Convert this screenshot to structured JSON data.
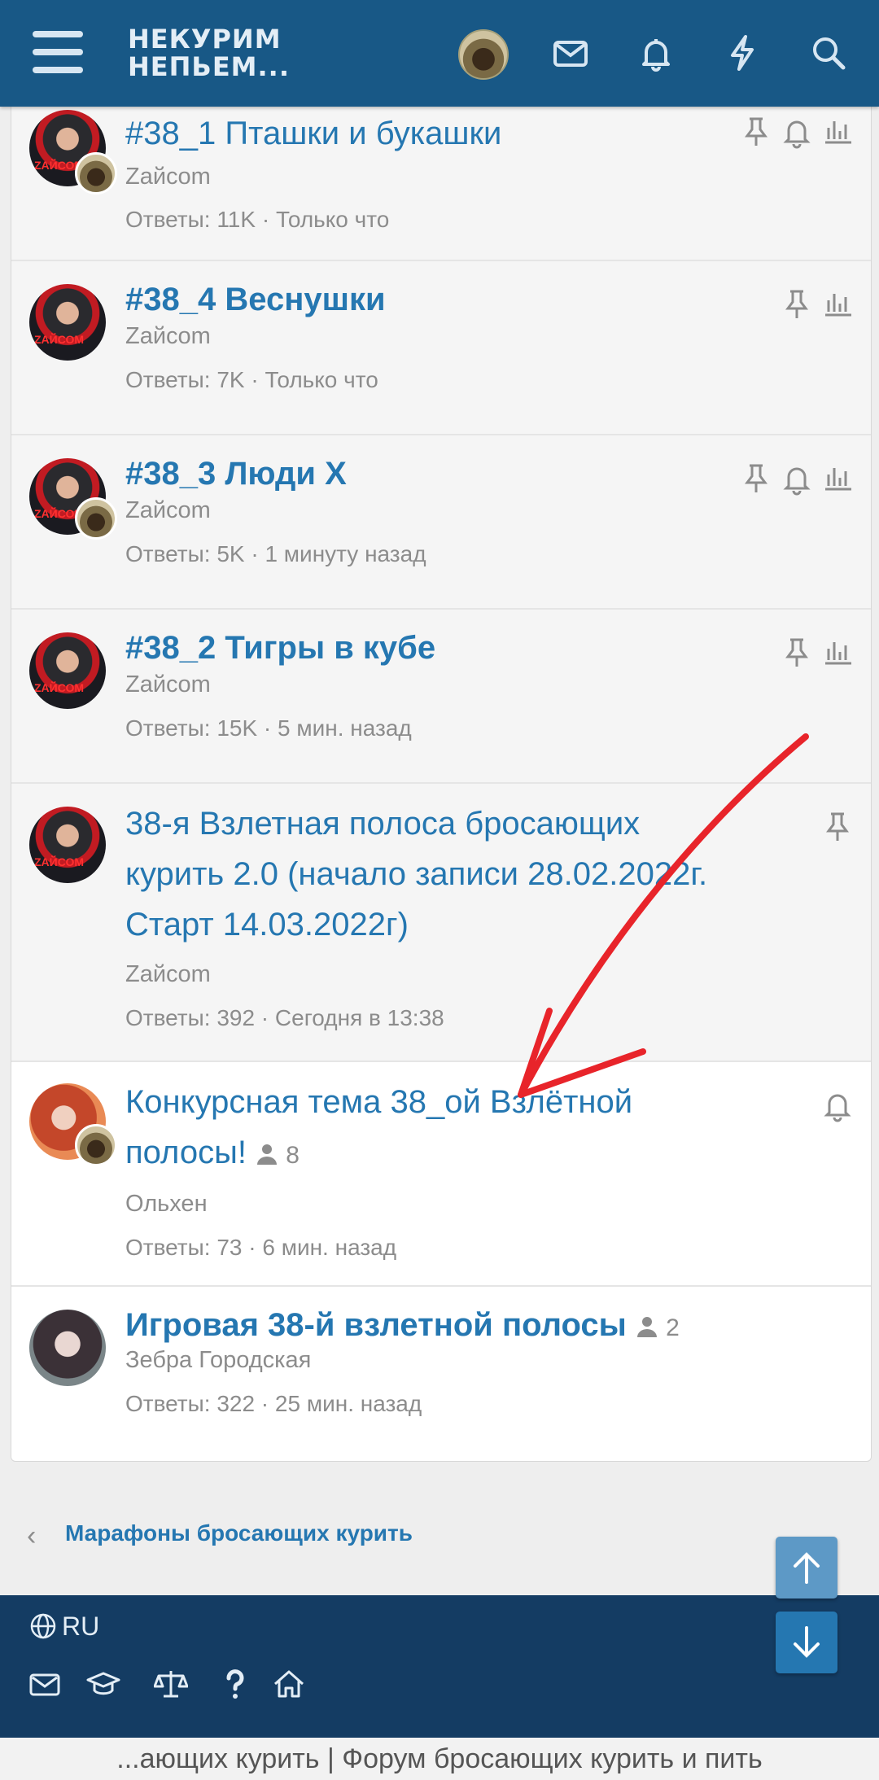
{
  "header": {
    "logo_line1": "НЕКУРИМ",
    "logo_line2": "НЕПЬЕМ..."
  },
  "threads": [
    {
      "title": "#38_1 Пташки и букашки",
      "author": "Zайcom",
      "meta": "Ответы: 11K · Только что",
      "bold": false,
      "icons": [
        "pin-icon",
        "bell-icon",
        "stats-icon"
      ]
    },
    {
      "title": "#38_4 Веснушки",
      "author": "Zайcom",
      "meta": "Ответы: 7K · Только что",
      "bold": true,
      "icons": [
        "pin-icon",
        "stats-icon"
      ]
    },
    {
      "title": "#38_3 Люди Х",
      "author": "Zайcom",
      "meta": "Ответы: 5K · 1 минуту назад",
      "bold": true,
      "icons": [
        "pin-icon",
        "bell-icon",
        "stats-icon"
      ]
    },
    {
      "title": "#38_2 Тигры в кубе",
      "author": "Zайcom",
      "meta": "Ответы: 15K · 5 мин. назад",
      "bold": true,
      "icons": [
        "pin-icon",
        "stats-icon"
      ]
    },
    {
      "title_lines": [
        "38-я Взлетная полоса бросающих",
        "курить 2.0 (начало записи 28.02.2022г.",
        "Старт 14.03.2022г)"
      ],
      "author": "Zайcom",
      "meta": "Ответы: 392 · Сегодня в 13:38",
      "icons": [
        "pin-icon"
      ]
    },
    {
      "title_lines": [
        "Конкурсная тема 38_ой Взлётной",
        "полосы!"
      ],
      "participants": "8",
      "author": "Ольхен",
      "meta": "Ответы: 73 · 6 мин. назад",
      "icons": [
        "bell-icon"
      ]
    },
    {
      "title": "Игровая 38-й взлетной полосы",
      "participants": "2",
      "author": "Зебра Городская",
      "meta": "Ответы: 322 · 25 мин. назад",
      "bold": true
    }
  ],
  "avatar_label": "ZАЙСОМ",
  "breadcrumb": "Марафоны бросающих курить",
  "footer": {
    "language": "RU"
  },
  "page_title_bar": "...ающих курить | Форум бросающих курить и пить",
  "colors": {
    "header": "#185886",
    "link": "#2577b1",
    "footer": "#143c63",
    "annotation_arrow": "#e8242a"
  }
}
